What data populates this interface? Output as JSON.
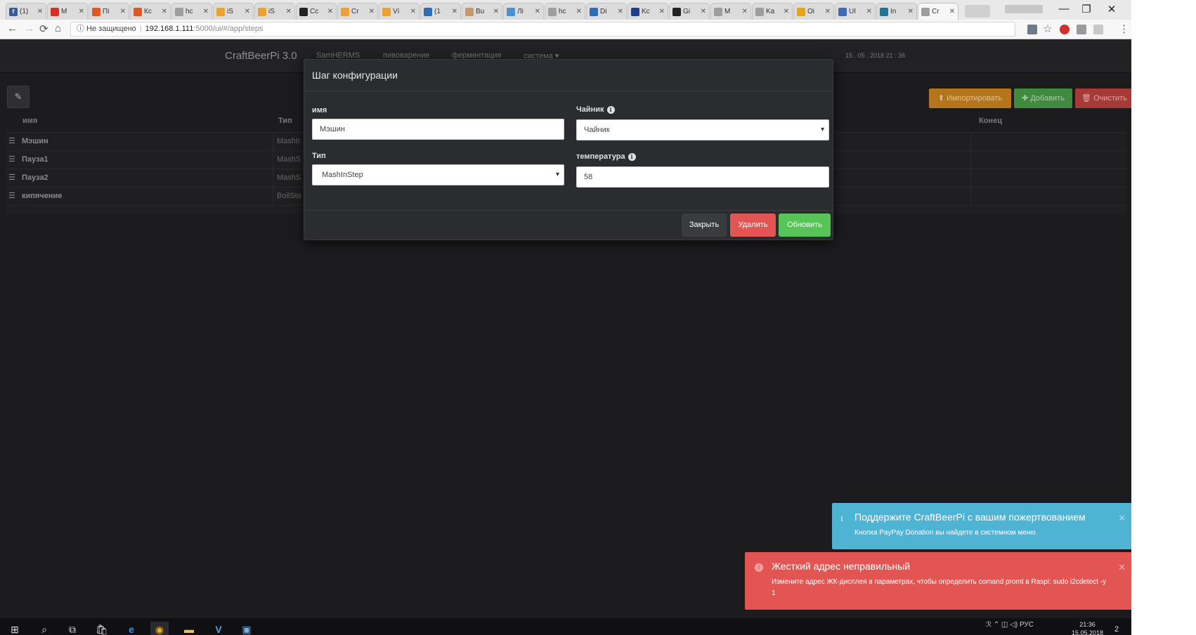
{
  "browser": {
    "tabs": [
      {
        "label": "(1)",
        "fav_color": "#3b5998",
        "fav_text": "f"
      },
      {
        "label": "M",
        "fav_color": "#d93025",
        "fav_text": ""
      },
      {
        "label": "Пі",
        "fav_color": "#e25822",
        "fav_text": ""
      },
      {
        "label": "Кс",
        "fav_color": "#e25822",
        "fav_text": ""
      },
      {
        "label": "hc",
        "fav_color": "#9e9e9e",
        "fav_text": ""
      },
      {
        "label": "iS",
        "fav_color": "#f0a030",
        "fav_text": ""
      },
      {
        "label": "iS",
        "fav_color": "#f0a030",
        "fav_text": ""
      },
      {
        "label": "Cc",
        "fav_color": "#222222",
        "fav_text": ""
      },
      {
        "label": "Cr",
        "fav_color": "#f0a030",
        "fav_text": ""
      },
      {
        "label": "Ví",
        "fav_color": "#f0a030",
        "fav_text": ""
      },
      {
        "label": "(1",
        "fav_color": "#2d6db5",
        "fav_text": ""
      },
      {
        "label": "Bu",
        "fav_color": "#c49a6c",
        "fav_text": ""
      },
      {
        "label": "Лі",
        "fav_color": "#4a90d9",
        "fav_text": ""
      },
      {
        "label": "hc",
        "fav_color": "#9e9e9e",
        "fav_text": ""
      },
      {
        "label": "Di",
        "fav_color": "#2d6db5",
        "fav_text": ""
      },
      {
        "label": "Kc",
        "fav_color": "#1e3f8a",
        "fav_text": ""
      },
      {
        "label": "Gi",
        "fav_color": "#222222",
        "fav_text": ""
      },
      {
        "label": "M",
        "fav_color": "#9e9e9e",
        "fav_text": ""
      },
      {
        "label": "Ka",
        "fav_color": "#9e9e9e",
        "fav_text": ""
      },
      {
        "label": "Oi",
        "fav_color": "#e8a317",
        "fav_text": ""
      },
      {
        "label": "UI",
        "fav_color": "#3d6cb5",
        "fav_text": ""
      },
      {
        "label": "In",
        "fav_color": "#21759b",
        "fav_text": ""
      },
      {
        "label": "Cr",
        "fav_color": "#9e9e9e",
        "fav_text": "",
        "active": true
      }
    ],
    "tab_close": "✕",
    "back": "←",
    "forward": "→",
    "reload": "⟳",
    "home": "⌂",
    "security_label": "ⓘ Не защищено",
    "url_host": "192.168.1.111",
    "url_path": ":5000/ui/#/app/steps",
    "star": "☆",
    "menu": "⋮",
    "minimize": "—",
    "maximize": "❐",
    "close": "✕"
  },
  "app": {
    "brand": "CraftBeerPi 3.0",
    "nav": [
      "SamHERMS",
      "пивоварение",
      "ферментация",
      "система ▾"
    ],
    "datetime": "15 . 05 . 2018 21 : 36",
    "edit_icon": "✎",
    "actions": [
      {
        "label": "⬆ Импортировать",
        "color": "#b5751a"
      },
      {
        "label": "✚ Добавить",
        "color": "#3f8a3f"
      },
      {
        "label": "🗑 Очистить",
        "color": "#a73a37"
      }
    ],
    "table": {
      "headers": [
        "имя",
        "Тип",
        "Конец"
      ],
      "rows": [
        {
          "name": "Мэшин",
          "type": "MashIr"
        },
        {
          "name": "Пауза1",
          "type": "MashS"
        },
        {
          "name": "Пауза2",
          "type": "MashS"
        },
        {
          "name": "кипячение",
          "type": "BoilSte"
        }
      ],
      "handle": "☰"
    }
  },
  "modal": {
    "title": "Шаг конфигурации",
    "name_label": "имя",
    "name_value": "Мэшин",
    "kettle_label": "Чайник",
    "kettle_value": "Чайник",
    "type_label": "Тип",
    "type_value": "MashInStep",
    "temp_label": "температура",
    "temp_value": "58",
    "info_glyph": "i",
    "close_btn": "Закрыть",
    "delete_btn": "Удалить",
    "update_btn": "Обновить"
  },
  "notifications": [
    {
      "title": "Поддержите CraftBeerPi с вашим пожертвованием",
      "message": "Кнопка PayPay Donation вы найдете в системном меню",
      "icon": "ℹ",
      "close": "✕",
      "color": "#4fb3d4"
    },
    {
      "title": "Жесткий адрес неправильный",
      "message": "Измените адрес ЖК-дисплея в параметрах, чтобы определить comand promt в Raspi: sudo i2cdetect -y 1",
      "icon": "!",
      "close": "✕",
      "color": "#e25553"
    }
  ],
  "taskbar": {
    "icons": [
      "⊞",
      "⌕",
      "⧉",
      "🛍",
      "e",
      "◉",
      "▬",
      "V",
      "▣"
    ],
    "tray": "ℛ  ⌃  ◫  ◁)  РУС",
    "time": "21:36",
    "date": "15.05.2018",
    "notif_count": "2"
  }
}
